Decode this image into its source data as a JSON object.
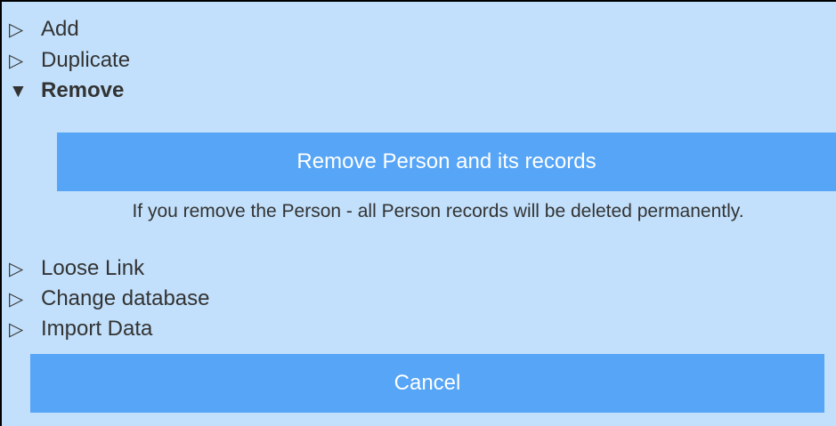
{
  "menu": {
    "items": [
      {
        "label": "Add",
        "caret": "▷",
        "icon": "collapsed-triangle-icon"
      },
      {
        "label": "Duplicate",
        "caret": "▷",
        "icon": "collapsed-triangle-icon"
      },
      {
        "label": "Remove",
        "caret": "▼",
        "icon": "expanded-triangle-icon"
      },
      {
        "label": "Loose Link",
        "caret": "▷",
        "icon": "collapsed-triangle-icon"
      },
      {
        "label": "Change database",
        "caret": "▷",
        "icon": "collapsed-triangle-icon"
      },
      {
        "label": "Import Data",
        "caret": "▷",
        "icon": "collapsed-triangle-icon"
      }
    ]
  },
  "remove_section": {
    "button_label": "Remove Person and its records",
    "warning": "If you remove the Person - all Person records will be deleted permanently."
  },
  "cancel_label": "Cancel",
  "colors": {
    "panel_background": "#c2e0fb",
    "button_background": "#56a5f7",
    "button_text": "#ffffff",
    "text": "#333333"
  }
}
